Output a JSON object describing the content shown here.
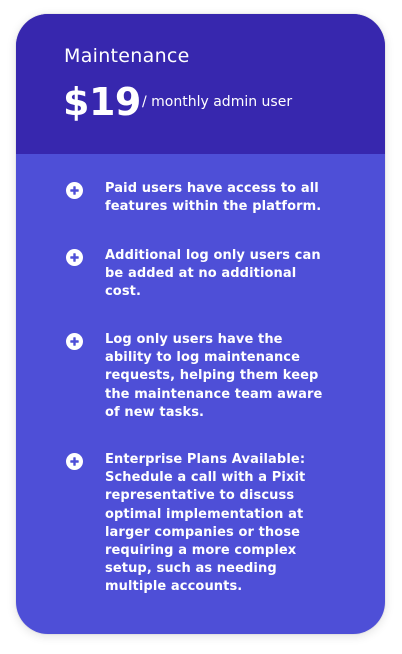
{
  "plan": {
    "name": "Maintenance",
    "price": "$19",
    "price_suffix": "/ monthly admin user"
  },
  "features": [
    {
      "icon": "plus-circle-icon",
      "text": "Paid users have access to all features within the platform."
    },
    {
      "icon": "plus-circle-icon",
      "text": "Additional log only users can be added at no additional cost."
    },
    {
      "icon": "plus-circle-icon",
      "text": "Log only users have the ability to log maintenance requests, helping them keep the maintenance team aware of new tasks."
    },
    {
      "icon": "plus-circle-icon",
      "text": "Enterprise Plans Available: Schedule a call with a Pixit representative to discuss optimal implementation at larger companies or those requiring a more complex setup, such as needing multiple accounts."
    }
  ],
  "colors": {
    "header_bg": "#3727ae",
    "body_bg": "#4e4fd7",
    "text": "#ffffff"
  }
}
